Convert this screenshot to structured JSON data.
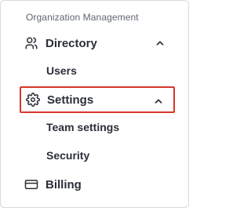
{
  "nav": {
    "section_title": "Organization Management",
    "items": [
      {
        "label": "Directory",
        "icon": "users-icon",
        "expanded": true
      },
      {
        "label": "Settings",
        "icon": "gear-icon",
        "expanded": true,
        "selected": true
      },
      {
        "label": "Billing",
        "icon": "credit-card-icon"
      }
    ],
    "subitems": {
      "directory": [
        "Users"
      ],
      "settings": [
        "Team settings",
        "Security"
      ]
    }
  },
  "colors": {
    "text": "#2b2f36",
    "muted": "#5f6570",
    "selected_border": "#d9362b",
    "panel_border": "#d9d9d9"
  }
}
